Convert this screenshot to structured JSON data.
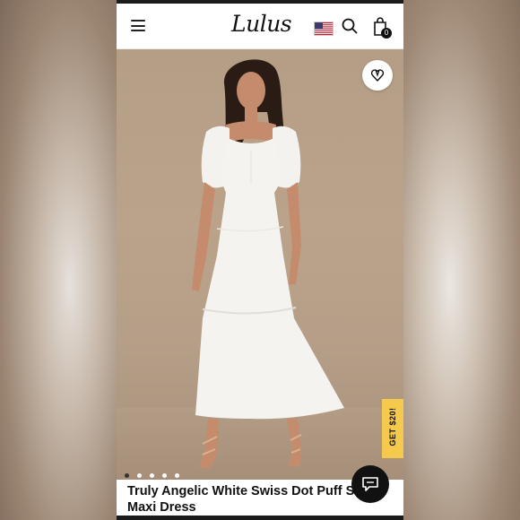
{
  "brand": {
    "logo_text": "Lulus"
  },
  "header": {
    "menu_icon": "hamburger-menu-icon",
    "flag_icon": "us-flag-icon",
    "search_icon": "search-icon",
    "bag_icon": "shopping-bag-icon",
    "bag_count": "0"
  },
  "hero": {
    "favorite_icon": "heart-icon",
    "promo_label": "GET $20!",
    "carousel": {
      "total": 5,
      "active": 1
    }
  },
  "product": {
    "title": "Truly Angelic White Swiss Dot Puff Sleeve Maxi Dress"
  },
  "chat": {
    "icon": "chat-bubble-icon"
  },
  "colors": {
    "accent_promo": "#f5c94c",
    "text": "#111111",
    "background": "#ffffff"
  }
}
